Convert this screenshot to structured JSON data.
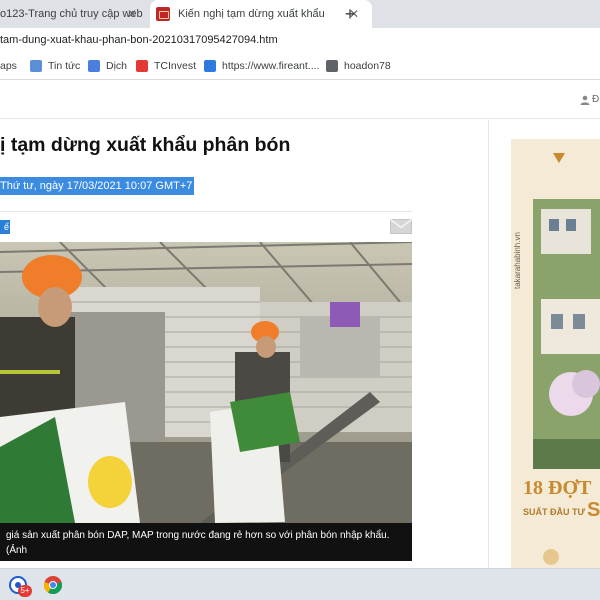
{
  "browser": {
    "tabs": [
      {
        "title": "o123-Trang chủ truy cập web",
        "active": false
      },
      {
        "title": "Kiến nghị tạm dừng xuất khẩu ph",
        "active": true
      }
    ],
    "close_glyph": "✕",
    "new_tab_glyph": "+",
    "url": "tam-dung-xuat-khau-phan-bon-20210317095427094.htm",
    "bookmarks": [
      {
        "label": "aps",
        "icon": ""
      },
      {
        "label": "Tin tức",
        "icon": "news-icon"
      },
      {
        "label": "Dịch",
        "icon": "translate-icon"
      },
      {
        "label": "TCInvest",
        "icon": "tcinvest-icon"
      },
      {
        "label": "https://www.fireant....",
        "icon": "fireant-icon"
      },
      {
        "label": "hoadon78",
        "icon": "hoadon-icon"
      }
    ]
  },
  "site": {
    "user_label": "Đ"
  },
  "article": {
    "headline": "ị tạm dừng xuất khẩu phân bón",
    "dateline": "Thứ tư, ngày 17/03/2021 10:07 GMT+7",
    "tag": "ể",
    "caption": "giá sản xuất phân bón DAP, MAP trong nước đang rẻ hơn so với phân bón nhập khẩu. (Ảnh"
  },
  "ad": {
    "vertical_text": "takarahabinh.vn",
    "big_text": "18 ĐỢT",
    "small_text": "SUẤT ĐẦU TƯ",
    "letter": "S"
  },
  "taskbar": {
    "badge": "5+"
  },
  "colors": {
    "tab_strip": "#dee1e6",
    "selection_blue": "#3b8be0",
    "ad_gold": "#c78a2e"
  }
}
